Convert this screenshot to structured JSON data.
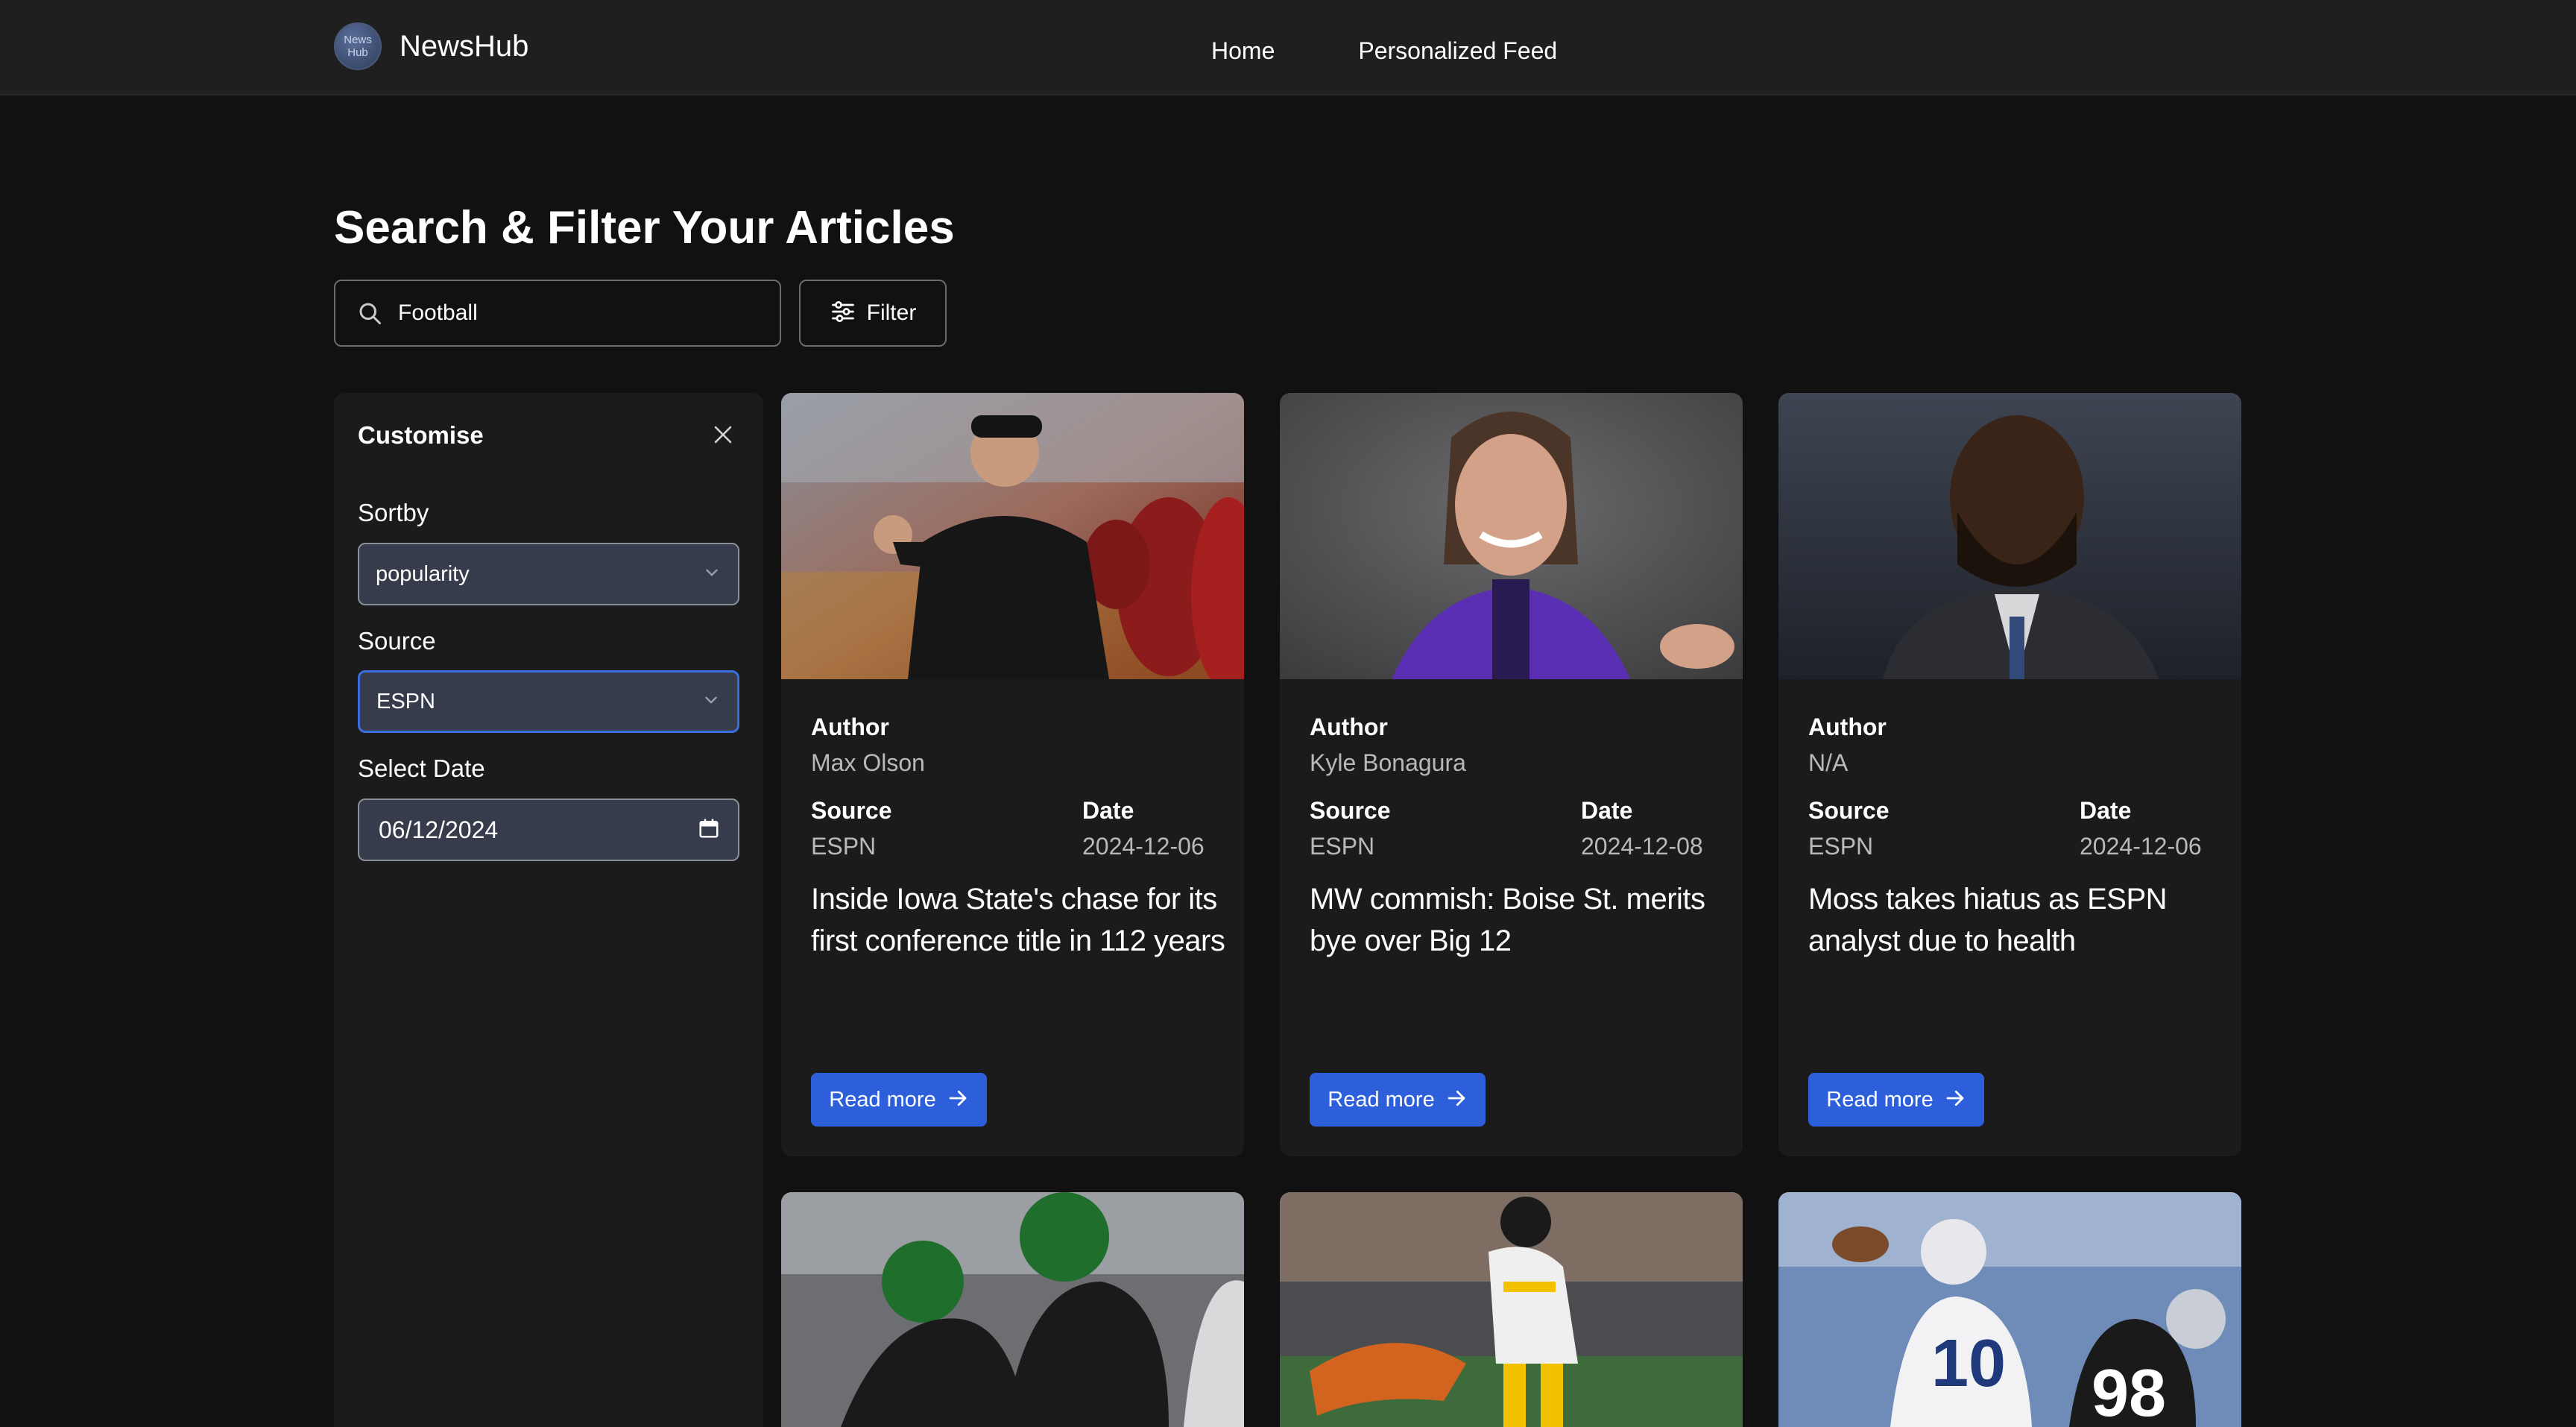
{
  "nav": {
    "logo_text": "News Hub",
    "brand": "NewsHub",
    "links": [
      {
        "label": "Home"
      },
      {
        "label": "Personalized Feed"
      }
    ]
  },
  "page_title": "Search & Filter Your Articles",
  "search": {
    "value": "Football",
    "icon": "search-icon"
  },
  "filter_button": {
    "label": "Filter",
    "icon": "sliders-icon"
  },
  "customise": {
    "title": "Customise",
    "sortby": {
      "label": "Sortby",
      "value": "popularity"
    },
    "source": {
      "label": "Source",
      "value": "ESPN"
    },
    "date": {
      "label": "Select Date",
      "value": "06/12/2024"
    }
  },
  "colors": {
    "accent": "#2c5fd9",
    "focus": "#3b6fe0",
    "background": "#111112",
    "card": "#1b1b1c"
  },
  "articles": [
    {
      "author_label": "Author",
      "author": "Max Olson",
      "source_label": "Source",
      "source": "ESPN",
      "date_label": "Date",
      "date": "2024-12-06",
      "title": "Inside Iowa State's chase for its first conference title in 112 years",
      "read_more": "Read more"
    },
    {
      "author_label": "Author",
      "author": "Kyle Bonagura",
      "source_label": "Source",
      "source": "ESPN",
      "date_label": "Date",
      "date": "2024-12-08",
      "title": "MW commish: Boise St. merits bye over Big 12",
      "read_more": "Read more"
    },
    {
      "author_label": "Author",
      "author": "N/A",
      "source_label": "Source",
      "source": "ESPN",
      "date_label": "Date",
      "date": "2024-12-06",
      "title": "Moss takes hiatus as ESPN analyst due to health",
      "read_more": "Read more"
    }
  ]
}
